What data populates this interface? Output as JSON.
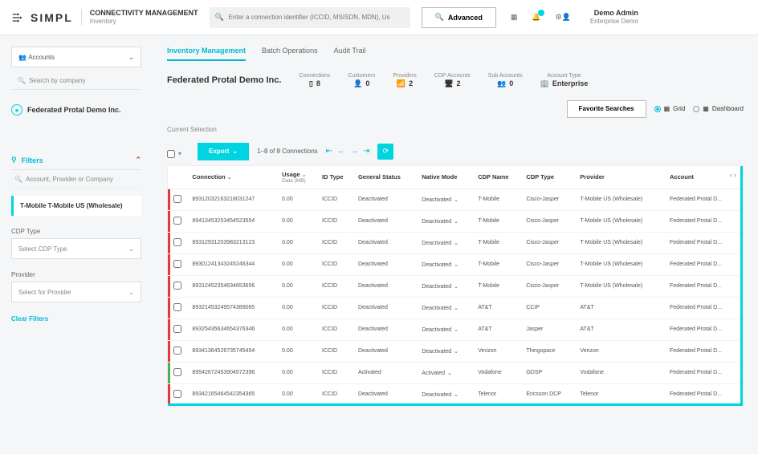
{
  "header": {
    "brand": "SIMPL",
    "title": "CONNECTIVITY MANAGEMENT",
    "subtitle": "Inventory",
    "search_placeholder": "Enter a connection identifier (ICCID, MSISDN, MDN), Us",
    "advanced": "Advanced",
    "user_name": "Demo Admin",
    "user_company": "Enterprise Demo"
  },
  "sidebar": {
    "accounts_label": "Accounts",
    "search_placeholder": "Search by company",
    "selected_account": "Federated Protal Demo Inc.",
    "filters_heading": "Filters",
    "filter_search_placeholder": "Account, Provider or Company",
    "filter_card": "T-Mobile T-Mobile US (Wholesale)",
    "cdp_type_label": "CDP Type",
    "cdp_type_placeholder": "Select CDP Type",
    "provider_label": "Provider",
    "provider_placeholder": "Select for Provider",
    "clear_filters": "Clear Filters"
  },
  "tabs": {
    "inventory": "Inventory Management",
    "batch": "Batch Operations",
    "audit": "Audit Trail"
  },
  "company": "Federated Protal Demo Inc.",
  "stats": {
    "connections_label": "Connections",
    "connections_value": "8",
    "customers_label": "Customers",
    "customers_value": "0",
    "providers_label": "Providers",
    "providers_value": "2",
    "cdp_label": "CDP Accounts",
    "cdp_value": "2",
    "sub_label": "Sub Accounts",
    "sub_value": "0",
    "type_label": "Account Type",
    "type_value": "Enterprise"
  },
  "toolbar": {
    "favorite": "Favorite Searches",
    "grid": "Grid",
    "dashboard": "Dashboard",
    "current_selection": "Current Selection",
    "export": "Export",
    "page_info": "1–8 of 8 Connections"
  },
  "table": {
    "cols": {
      "connection": "Connection",
      "usage": "Usage",
      "usage_sub": "Data (MB)",
      "id_type": "ID Type",
      "general_status": "General Status",
      "native_mode": "Native Mode",
      "cdp_name": "CDP Name",
      "cdp_type": "CDP Type",
      "provider": "Provider",
      "account": "Account"
    },
    "rows": [
      {
        "bar": "red",
        "conn": "89312032163218031247",
        "usage": "0.00",
        "idtype": "ICCID",
        "gs": "Deactivated",
        "nm": "Deactivated",
        "cdpn": "T-Mobile",
        "cdpt": "Cisco-Jasper",
        "prov": "T-Mobile US (Wholesale)",
        "acct": "Federated Protal D..."
      },
      {
        "bar": "red",
        "conn": "89413453253454523554",
        "usage": "0.00",
        "idtype": "ICCID",
        "gs": "Deactivated",
        "nm": "Deactivated",
        "cdpn": "T-Mobile",
        "cdpt": "Cisco-Jasper",
        "prov": "T-Mobile US (Wholesale)",
        "acct": "Federated Protal D..."
      },
      {
        "bar": "red",
        "conn": "89312931203983213123",
        "usage": "0.00",
        "idtype": "ICCID",
        "gs": "Deactivated",
        "nm": "Deactivated",
        "cdpn": "T-Mobile",
        "cdpt": "Cisco-Jasper",
        "prov": "T-Mobile US (Wholesale)",
        "acct": "Federated Protal D..."
      },
      {
        "bar": "red",
        "conn": "89301241343245246344",
        "usage": "0.00",
        "idtype": "ICCID",
        "gs": "Deactivated",
        "nm": "Deactivated",
        "cdpn": "T-Mobile",
        "cdpt": "Cisco-Jasper",
        "prov": "T-Mobile US (Wholesale)",
        "acct": "Federated Protal D..."
      },
      {
        "bar": "red",
        "conn": "89312452354634653656",
        "usage": "0.00",
        "idtype": "ICCID",
        "gs": "Deactivated",
        "nm": "Deactivated",
        "cdpn": "T-Mobile",
        "cdpt": "Cisco-Jasper",
        "prov": "T-Mobile US (Wholesale)",
        "acct": "Federated Protal D..."
      },
      {
        "bar": "red",
        "conn": "89321453249574389065",
        "usage": "0.00",
        "idtype": "ICCID",
        "gs": "Deactivated",
        "nm": "Deactivated",
        "cdpn": "AT&T",
        "cdpt": "CCIP",
        "prov": "AT&T",
        "acct": "Federated Protal D..."
      },
      {
        "bar": "red",
        "conn": "89325435634654376346",
        "usage": "0.00",
        "idtype": "ICCID",
        "gs": "Deactivated",
        "nm": "Deactivated",
        "cdpn": "AT&T",
        "cdpt": "Jasper",
        "prov": "AT&T",
        "acct": "Federated Protal D..."
      },
      {
        "bar": "red",
        "conn": "89341364526735745454",
        "usage": "0.00",
        "idtype": "ICCID",
        "gs": "Deactivated",
        "nm": "Deactivated",
        "cdpn": "Verizon",
        "cdpt": "Thingspace",
        "prov": "Verizon",
        "acct": "Federated Protal D..."
      },
      {
        "bar": "green",
        "conn": "89542672453904572396",
        "usage": "0.00",
        "idtype": "ICCID",
        "gs": "Activated",
        "nm": "Activated",
        "cdpn": "Vodafone",
        "cdpt": "GDSP",
        "prov": "Vodafone",
        "acct": "Federated Protal D..."
      },
      {
        "bar": "red",
        "conn": "89342165464542354365",
        "usage": "0.00",
        "idtype": "ICCID",
        "gs": "Deactivated",
        "nm": "Deactivated",
        "cdpn": "Telenor",
        "cdpt": "Ericsson DCP",
        "prov": "Telenor",
        "acct": "Federated Protal D..."
      }
    ]
  }
}
